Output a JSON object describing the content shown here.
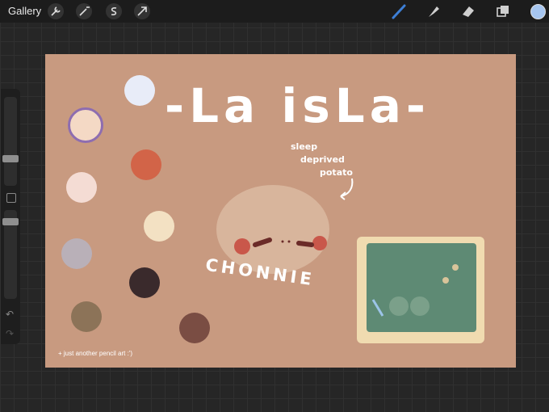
{
  "app": {
    "gallery_label": "Gallery"
  },
  "toolbar": {
    "left_tools": [
      "wrench-icon",
      "magic-wand-icon",
      "selection-icon",
      "transform-arrow-icon"
    ],
    "right_tools": [
      "brush-icon",
      "smudge-icon",
      "eraser-icon",
      "layers-icon"
    ],
    "active_color": "#a7c6f0",
    "brush_accent": "#3d7fd6"
  },
  "artwork": {
    "title": "-La isLa-",
    "subtitle_line1": "sleep",
    "subtitle_line2": "deprived",
    "subtitle_line3": "potato",
    "name": "CHONNIE",
    "footer_note": "+ just another pencil art :')",
    "background": "#c89a80"
  }
}
